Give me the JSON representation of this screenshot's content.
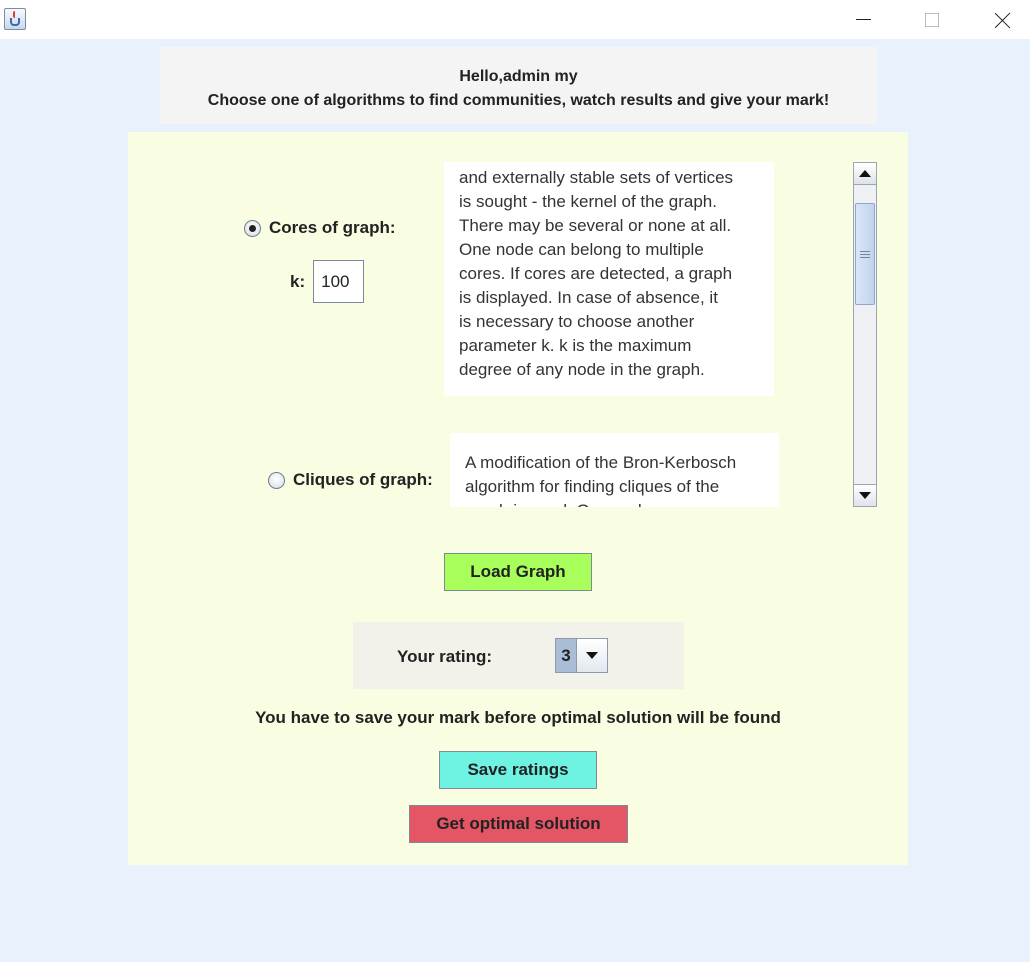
{
  "window": {
    "app_icon": "java-cup-icon",
    "controls": [
      "minimize-icon",
      "maximize-icon",
      "close-icon"
    ]
  },
  "header": {
    "greeting": "Hello,admin my",
    "instruction": "Choose one of algorithms to find communities, watch results and give your mark!"
  },
  "algorithms": [
    {
      "label": "Cores of graph:",
      "selected": true,
      "description_lines": [
        "and externally stable sets of vertices",
        "is sought - the kernel of the graph.",
        "There may be several or none at all.",
        "One node can belong to multiple",
        "cores. If cores are detected, a graph",
        "is displayed. In case of absence, it",
        "is necessary to choose another",
        "parameter k. k is the maximum",
        "degree of any node in the graph."
      ]
    },
    {
      "label": "Cliques of graph:",
      "selected": false,
      "description_lines": [
        "A modification of the Bron-Kerbosch",
        "algorithm for finding cliques of the",
        "graph is used. One node can"
      ]
    }
  ],
  "k_param": {
    "label": "k:",
    "value": "100"
  },
  "buttons": {
    "load_graph": "Load Graph",
    "save_ratings": "Save ratings",
    "get_optimal": "Get optimal solution"
  },
  "rating": {
    "label": "Your rating:",
    "selected": "3"
  },
  "save_note": "You have to save your mark before optimal solution will be found",
  "colors": {
    "background": "#e9f2fc",
    "panel": "#f9fde2",
    "load_button": "#a8ff5c",
    "save_button": "#6ef3e3",
    "optimal_button": "#e45565"
  }
}
